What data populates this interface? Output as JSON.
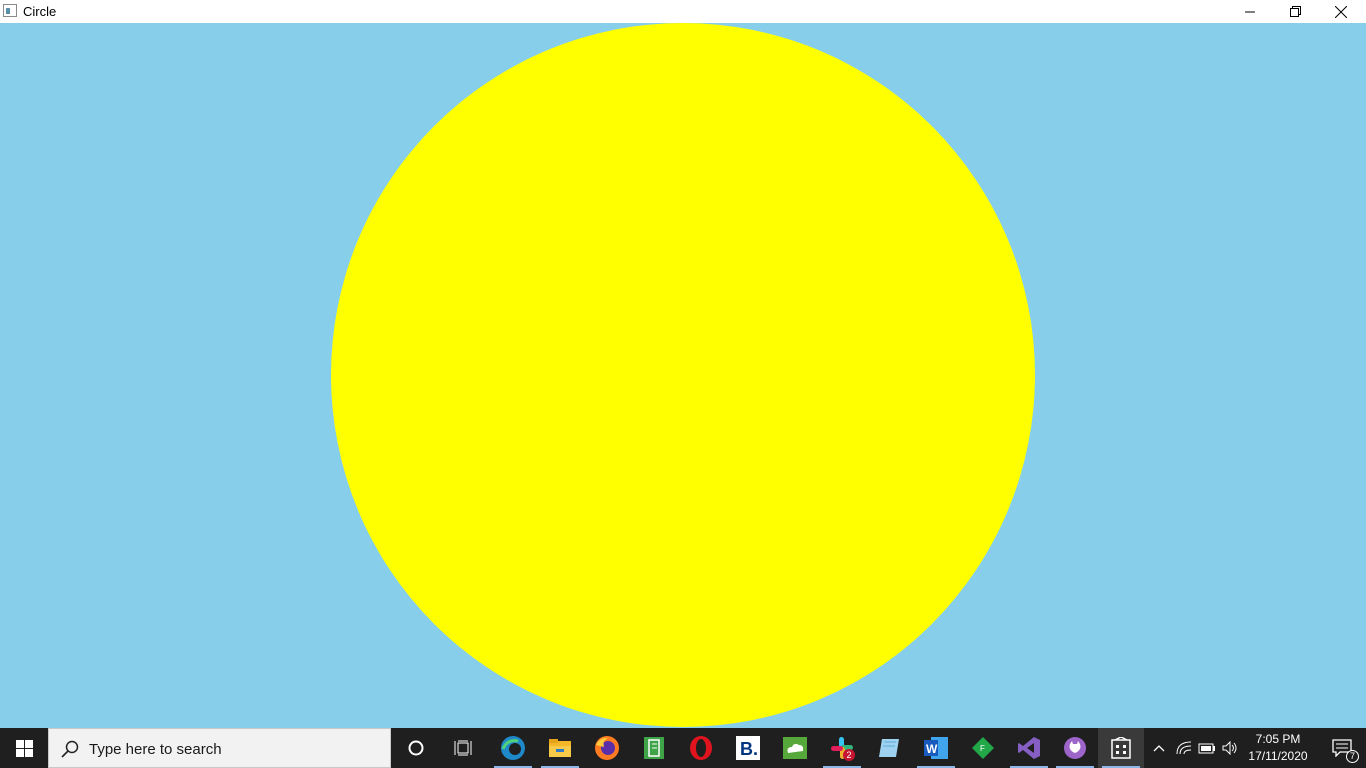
{
  "window": {
    "title": "Circle",
    "background_color": "#87ceeb",
    "circle_color": "#ffff00"
  },
  "titlebar_buttons": {
    "minimize": "minimize-icon",
    "restore": "restore-icon",
    "close": "close-icon"
  },
  "taskbar": {
    "search_placeholder": "Type here to search",
    "pinned": [
      {
        "name": "cortana",
        "icon": "cortana-circle-icon"
      },
      {
        "name": "task-view",
        "icon": "task-view-icon"
      },
      {
        "name": "edge",
        "icon": "edge-icon"
      },
      {
        "name": "file-explorer",
        "icon": "folder-icon"
      },
      {
        "name": "firefox",
        "icon": "firefox-icon"
      },
      {
        "name": "notes",
        "icon": "green-notebook-icon"
      },
      {
        "name": "opera",
        "icon": "opera-icon"
      },
      {
        "name": "booking",
        "icon": "booking-b-icon"
      },
      {
        "name": "cloud-app",
        "icon": "green-cloud-icon"
      },
      {
        "name": "slack",
        "icon": "slack-icon"
      },
      {
        "name": "scratchpad",
        "icon": "paper-icon"
      },
      {
        "name": "word",
        "icon": "word-icon"
      },
      {
        "name": "pycharm-like",
        "icon": "green-diamond-icon"
      },
      {
        "name": "visual-studio",
        "icon": "visual-studio-icon"
      },
      {
        "name": "github-desktop",
        "icon": "github-icon"
      },
      {
        "name": "circle-app",
        "icon": "app-window-icon"
      }
    ],
    "slack_badge": "2",
    "clock_time": "7:05 PM",
    "clock_date": "17/11/2020",
    "notification_count": "7"
  }
}
